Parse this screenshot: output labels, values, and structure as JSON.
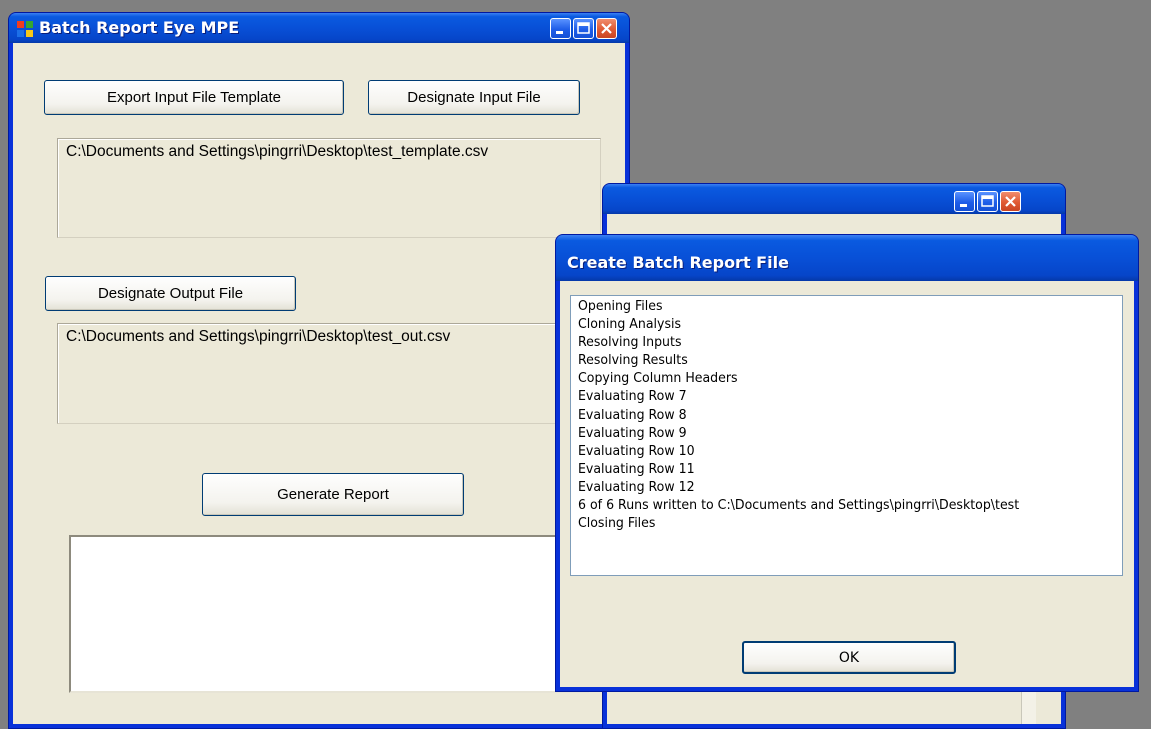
{
  "main_window": {
    "title": "Batch Report Eye MPE",
    "export_template_label": "Export Input File Template",
    "designate_input_label": "Designate Input File",
    "input_path": "C:\\Documents and Settings\\pingrri\\Desktop\\test_template.csv",
    "designate_output_label": "Designate Output File",
    "output_path": "C:\\Documents and Settings\\pingrri\\Desktop\\test_out.csv",
    "generate_label": "Generate Report"
  },
  "dialog": {
    "title": "Create Batch Report File",
    "log": [
      "Opening Files",
      "Cloning Analysis",
      "Resolving Inputs",
      "Resolving Results",
      "Copying Column Headers",
      "Evaluating Row 7",
      "Evaluating Row 8",
      "Evaluating Row 9",
      "Evaluating Row 10",
      "Evaluating Row 11",
      "Evaluating Row 12",
      "6 of 6 Runs written to C:\\Documents and Settings\\pingrri\\Desktop\\test",
      "Closing Files"
    ],
    "ok_label": "OK"
  },
  "icons": {
    "app_icon": "windows-app-icon",
    "minimize": "minimize-icon",
    "maximize": "maximize-icon",
    "close": "close-icon"
  },
  "colors": {
    "titlebar_blue": "#0a5ae0",
    "window_face": "#ece9d8",
    "desktop": "#808080",
    "close_red": "#e05a34"
  }
}
